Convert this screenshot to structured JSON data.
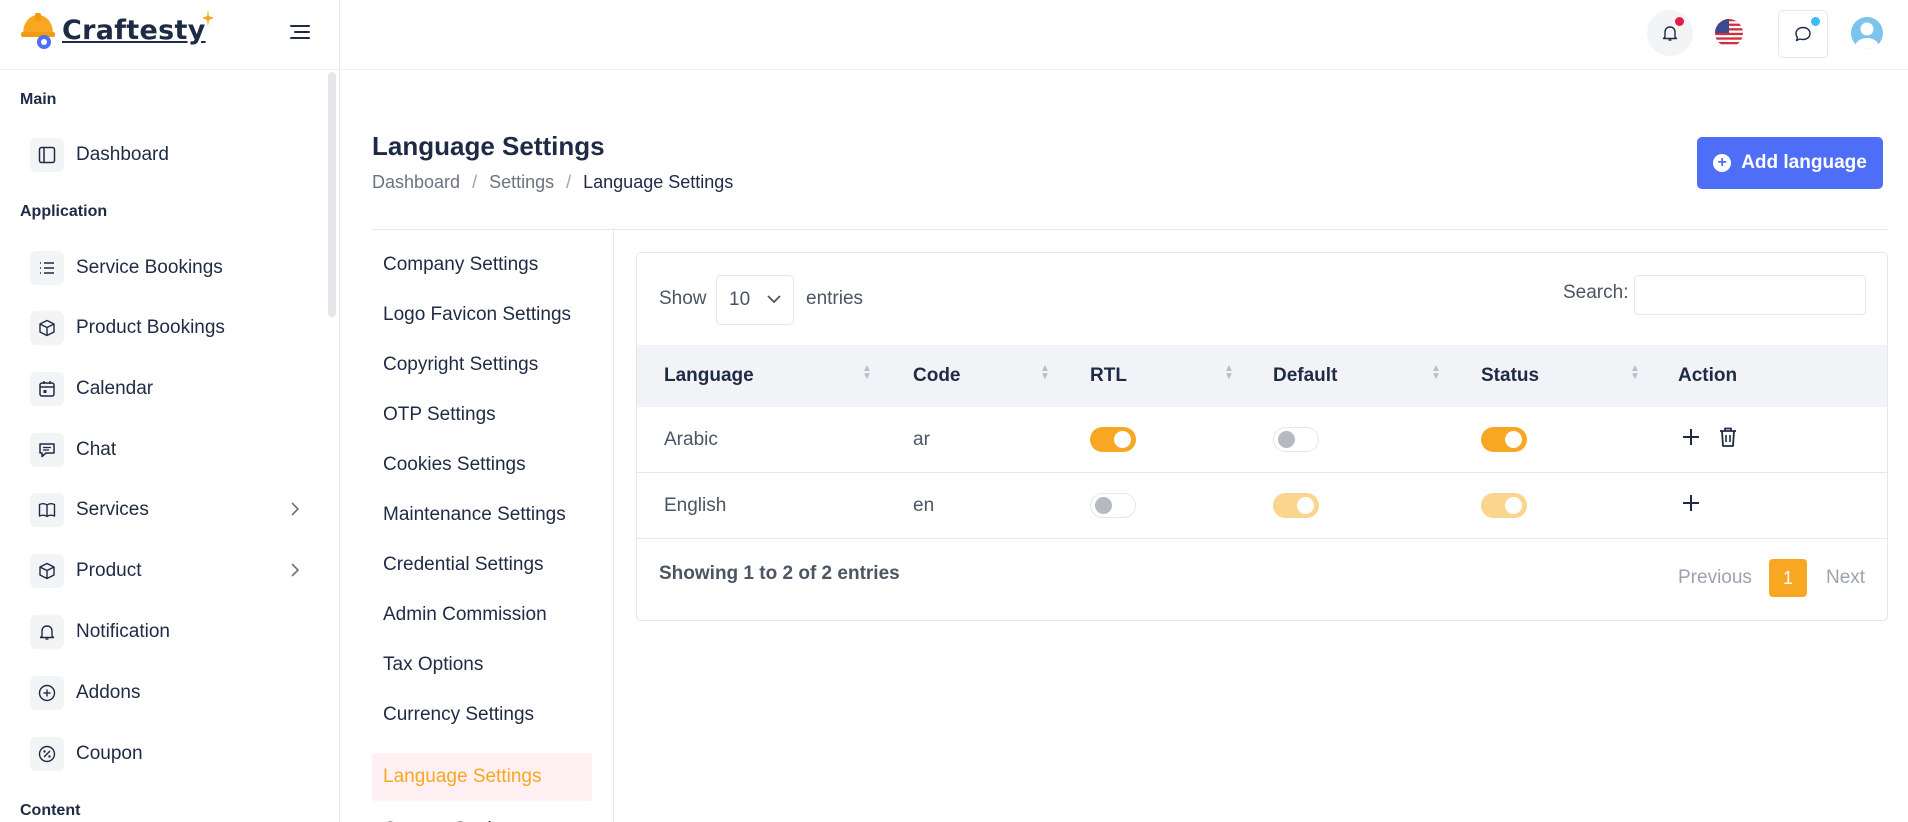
{
  "brand": {
    "name": "Craftesty"
  },
  "sidebar": {
    "sections": [
      {
        "title": "Main"
      },
      {
        "title": "Application"
      },
      {
        "title": "Content"
      }
    ],
    "items": [
      {
        "label": "Dashboard",
        "icon": "layout-icon"
      },
      {
        "label": "Service Bookings",
        "icon": "list-icon"
      },
      {
        "label": "Product Bookings",
        "icon": "box-icon"
      },
      {
        "label": "Calendar",
        "icon": "calendar-icon"
      },
      {
        "label": "Chat",
        "icon": "chat-icon"
      },
      {
        "label": "Services",
        "icon": "book-icon",
        "has_children": true
      },
      {
        "label": "Product",
        "icon": "box-icon",
        "has_children": true
      },
      {
        "label": "Notification",
        "icon": "bell-icon"
      },
      {
        "label": "Addons",
        "icon": "plus-circle-icon"
      },
      {
        "label": "Coupon",
        "icon": "percent-icon"
      }
    ]
  },
  "topbar": {
    "icons": [
      "bell-icon",
      "us-flag-icon",
      "message-icon",
      "avatar"
    ],
    "colors": {
      "notification_dot": "#e11d48",
      "message_dot": "#38bdf8"
    }
  },
  "header": {
    "title": "Language Settings",
    "breadcrumb": [
      "Dashboard",
      "Settings",
      "Language Settings"
    ],
    "add_button_label": "Add language"
  },
  "submenu": {
    "items": [
      "Company Settings",
      "Logo Favicon Settings",
      "Copyright Settings",
      "OTP Settings",
      "Cookies Settings",
      "Maintenance Settings",
      "Credential Settings",
      "Admin Commission",
      "Tax Options",
      "Currency Settings",
      "Language Settings",
      "Custom Settings"
    ],
    "active_index": 10
  },
  "table": {
    "show_label": "Show",
    "page_size": "10",
    "entries_label": "entries",
    "search_label": "Search:",
    "columns": [
      "Language",
      "Code",
      "RTL",
      "Default",
      "Status",
      "Action"
    ],
    "rows": [
      {
        "language": "Arabic",
        "code": "ar",
        "rtl": true,
        "default": false,
        "status": true,
        "status_disabled": false,
        "deletable": true
      },
      {
        "language": "English",
        "code": "en",
        "rtl": false,
        "default": true,
        "default_disabled": true,
        "status": true,
        "status_disabled": true,
        "deletable": false
      }
    ],
    "info": "Showing 1 to 2 of 2 entries",
    "pagination": {
      "previous": "Previous",
      "current": "1",
      "next": "Next"
    }
  },
  "colors": {
    "accent": "#f7a721",
    "primary": "#4f6ef7",
    "active_bg": "#fff1f3"
  }
}
